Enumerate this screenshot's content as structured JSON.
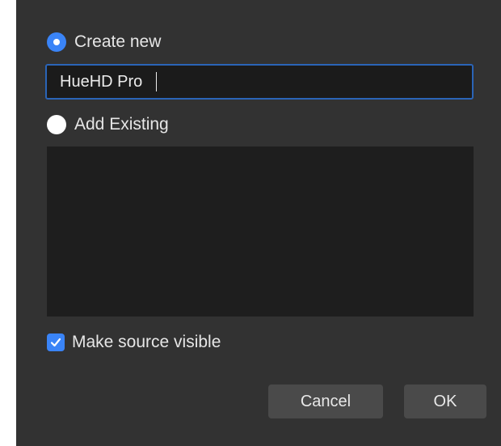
{
  "dialog": {
    "create_new": {
      "label": "Create new",
      "selected": true
    },
    "name_input": {
      "value": "HueHD Pro"
    },
    "add_existing": {
      "label": "Add Existing",
      "selected": false
    },
    "existing_list": {
      "items": []
    },
    "make_visible": {
      "label": "Make source visible",
      "checked": true
    },
    "buttons": {
      "cancel_label": "Cancel",
      "ok_label": "OK"
    }
  },
  "colors": {
    "dialog_background": "#323232",
    "accent": "#3a84f7",
    "input_border": "#2a64b7",
    "list_background": "#1e1e1e",
    "button_background": "#4a4a4a"
  },
  "icons": {
    "checkbox": "checkmark-icon",
    "radio_selected": "radio-selected-icon",
    "radio_unselected": "radio-unselected-icon"
  }
}
